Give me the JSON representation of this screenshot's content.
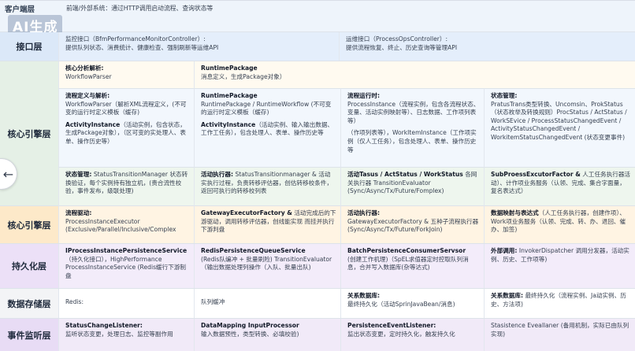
{
  "watermark": "AI生成",
  "nav": {
    "prev_glyph": "←"
  },
  "client": {
    "label": "客户端层",
    "text": "前端/外部系统：通过HTTP调用启动流程、查询状态等"
  },
  "interface": {
    "label": "接口层",
    "cells": [
      {
        "title": "监控接口（BfmPerformanceMonitorController）:",
        "desc": "提供队列状态、消费统计、健康检查、强制刷新等运维API"
      },
      {
        "title": "运维接口（ProcessOpsController）:",
        "desc": "提供流程恢复、终止、历史查询等管理API"
      }
    ]
  },
  "core": {
    "label": "核心引擎层",
    "top": [
      {
        "title": "核心分析解析:",
        "desc": "WorkflowParser"
      },
      {
        "title": "RuntimePackage",
        "desc": "消息定义，生成Package对象）"
      }
    ],
    "mid": [
      {
        "title": "流程定义与解析:",
        "desc": "WorkflowParser（解析XML流程定义，(不可变的运行时定义模板（缓存)"
      },
      {
        "title": "RuntimePackage",
        "desc": "RuntimePackage / RuntimeWorkflow (不可变的运行时定义模板（缓存)"
      },
      {
        "title": "流程运行时:",
        "desc": "ProcessInstance（流程实例，包含各流程状态、变量、活动实例映射等）、日志数据、工作项列表等）"
      },
      {
        "title": "状态管理:",
        "desc": "PratusTrans类型转换、Uncomsin、ProkStatus（状态枚举及转换规则）ProcStatus / ActStatus / WorkSEvice / ProcessStatusChangedEvent / ActivityStatusChangedEvent / WorkitemStatusChangedEvent (状态变更事件)"
      }
    ],
    "sub": [
      {
        "title": "ActivityInstance",
        "desc": "（活动实例，包含状态，生成Package对象），（区可变的实处理人、表单、操作历史等）"
      },
      {
        "title": "ActivityInstance",
        "desc": "（活动实例、输入输出数据、工作工任务），包含处理人、表单、操作历史等"
      },
      {
        "title": "",
        "desc": "（作项列表等），WorkItemInstance（工作项实例（仅人工任务），包含处理人、表单、操作历史等"
      }
    ],
    "bottom": [
      {
        "title": "状态管理:",
        "desc": "StatusTransitionManager 状态转换验证，每个实例持有独立机，(责合流性校验，事件发布，级联处理)"
      },
      {
        "title": "活动执行器:",
        "desc": "StatusTransitionmanager & 活动实执行过程，负责转移评估器，创估转移校条件，返回可执行的转移校列表"
      },
      {
        "title": "活动Tasus / ActStatus / WorkStatus",
        "desc": "各网关执行器 TransitionEvaluator (Sync/Async/Tx/Future/Fomplex)"
      },
      {
        "title": "SubProessExcutorFactor &",
        "desc": "人工任务执行器活动）、计作项业务服务（认领、完成、集合字面量，复名表达式）"
      }
    ]
  },
  "core2": {
    "label": "核心引擎层",
    "cells": [
      {
        "title": "流程驱动:",
        "desc": "ProcessInstanceExecutor (Exclusive/Parallel/Inclusive/Complex"
      },
      {
        "title": "GatewayExecutorFactory &",
        "desc": "活动完成后的下游驱动，调用转移评估器，创线能实现 而挂并执行下游判盘"
      },
      {
        "title": "活动执行器:",
        "desc": "GatewayExecutorFactory & 五种子流程执行器 (Sync/Async/Tx/Future/ForkJoin)"
      },
      {
        "title": "数据映射与表达式",
        "desc": "（人工任务执行器，创建作项）、Work项业务服务（认领、完成、转、办、退回、催办、加签)"
      }
    ]
  },
  "persist": {
    "label": "持久化层",
    "cells": [
      {
        "title": "IProcessInstancePersistenceService",
        "desc": "（持久化接口），HighPerformance ProcessInstanceService (Redis缓行下游制盘"
      },
      {
        "title": "RedisPersistenceQueueService",
        "desc": "(Redis队编冲 + 批量刷险) TransitionEvaluator（输出数据处理列操作（入队、批量出队)"
      },
      {
        "title": "BatchPersistenceConsumerServsor",
        "desc": "(创建工作机理)（SpEL求值器定时控取队列消息，合并写入数据库(杂等达式)"
      },
      {
        "title": "外部调用:",
        "desc": "InvokerDispatcher 调用分发器，活动实例、历史、工作项等)"
      }
    ]
  },
  "store": {
    "label": "数据存储层",
    "cells": [
      {
        "title": "",
        "desc": "Redis:"
      },
      {
        "title": "",
        "desc": "队列缓冲"
      },
      {
        "title": "关系数据库:",
        "desc": "最终持久化（活动SprinJavaBean/消息)"
      },
      {
        "title": "关系数据库:",
        "desc": "最终持久化（流程实例、Ja动实例、历史、方法项)"
      }
    ]
  },
  "event": {
    "label": "事件监听层",
    "cells": [
      {
        "title": "StatusChangeListener:",
        "desc": "监听状态变更，处理日志、监控等副作用"
      },
      {
        "title": "DataMapping InputProcessor",
        "desc": "输入数据预性，类型转换、必填校验)"
      },
      {
        "title": "PersistenceEventListener:",
        "desc": "监出状态变更，定时持久化，触发持久化"
      },
      {
        "title": "",
        "desc": "Stasistence Eveallaner (备用机制，实际已由队列实现)"
      }
    ]
  }
}
